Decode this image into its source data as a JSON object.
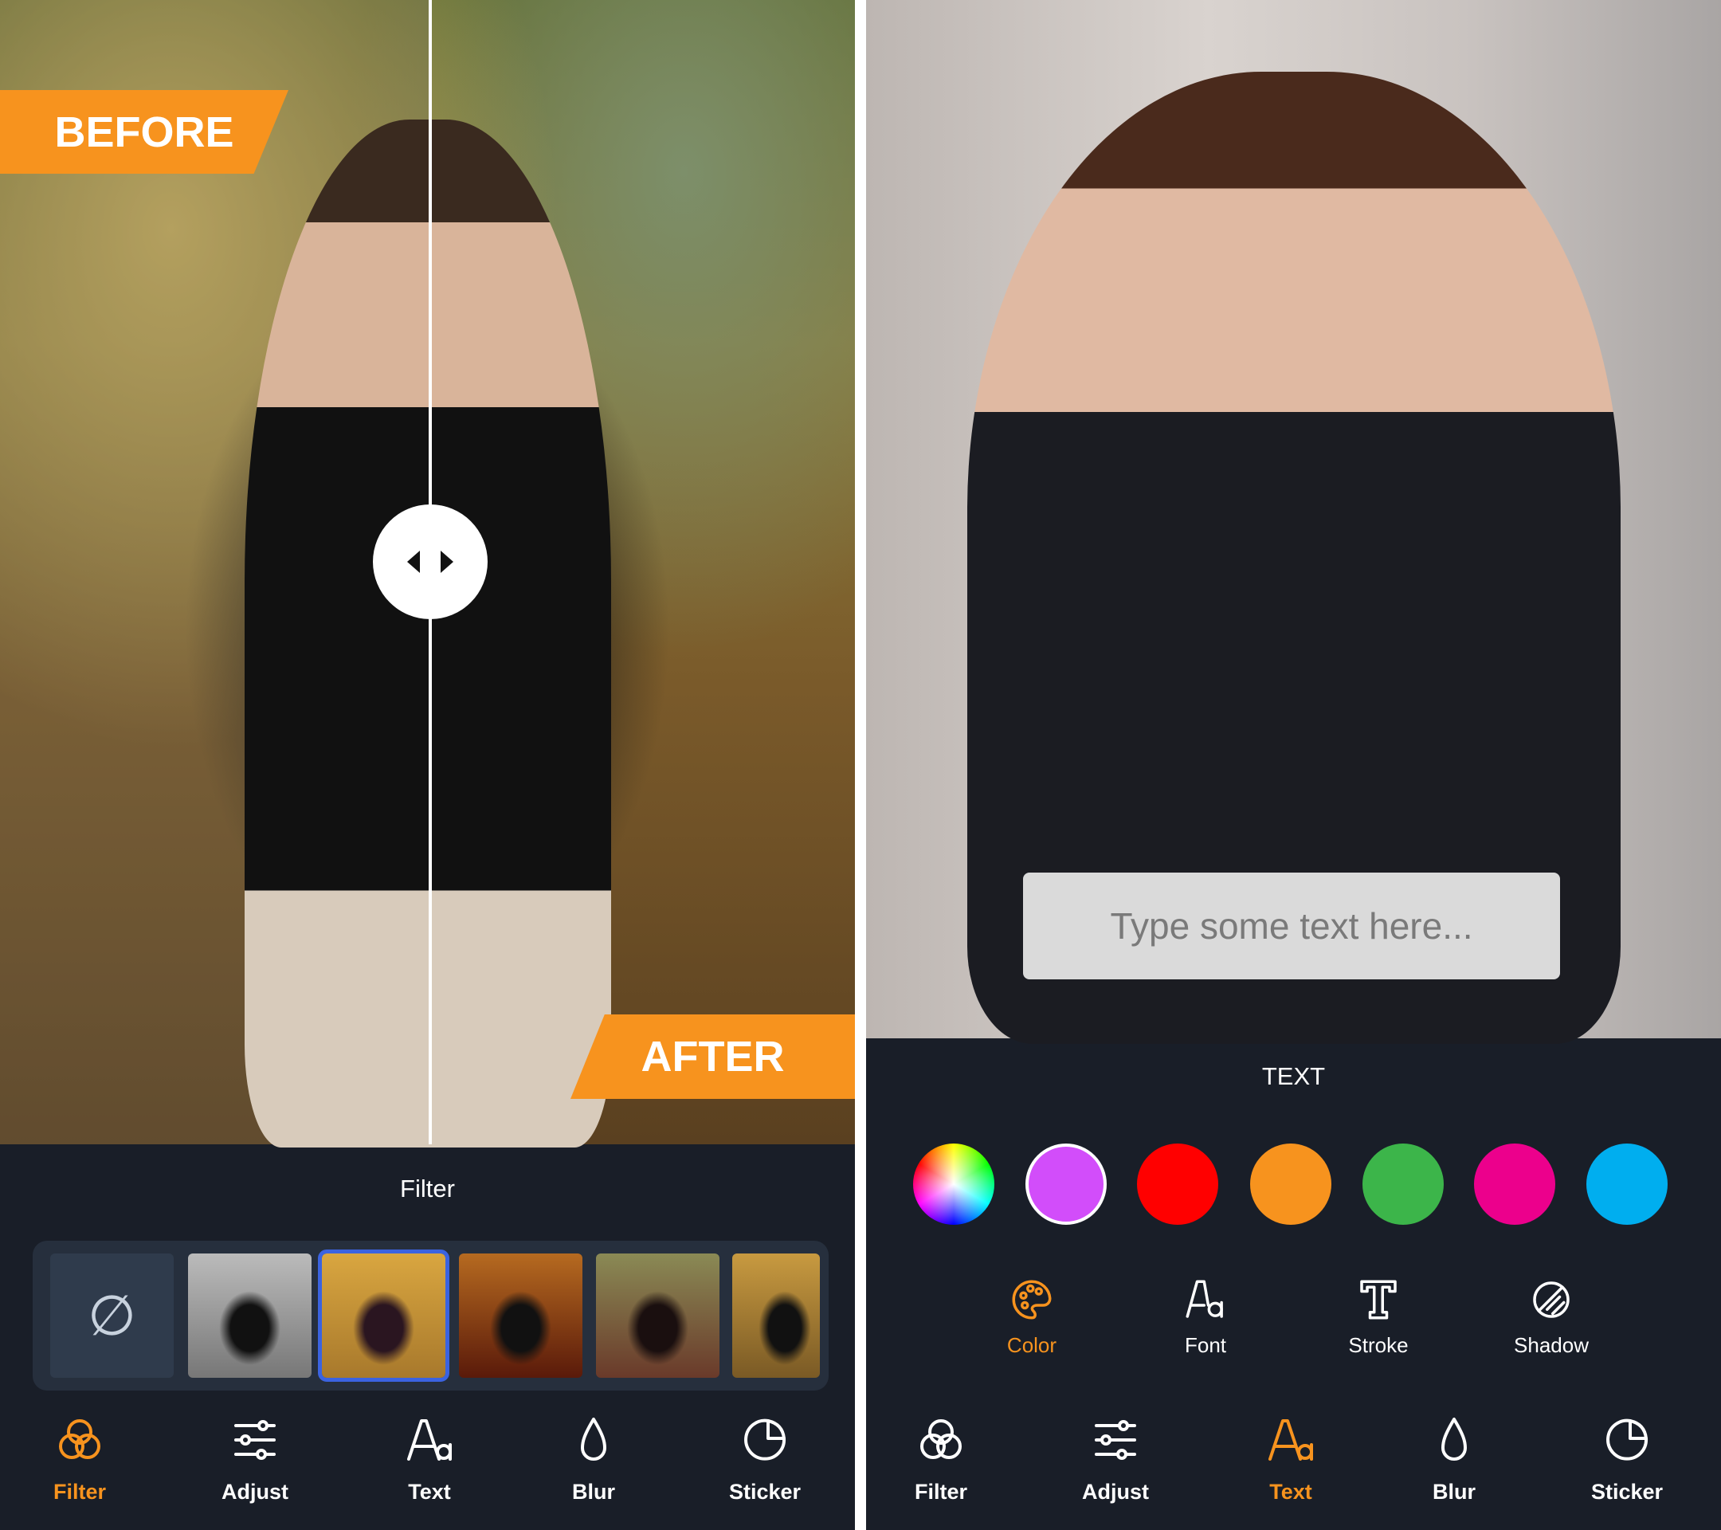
{
  "left": {
    "before_label": "BEFORE",
    "after_label": "AFTER",
    "section_title": "Filter",
    "filters": [
      {
        "name": "none",
        "icon": "no-filter-icon",
        "symbol": "∅"
      },
      {
        "name": "grayscale",
        "selected": false
      },
      {
        "name": "warm",
        "selected": true
      },
      {
        "name": "vivid-red",
        "selected": false
      },
      {
        "name": "faded",
        "selected": false
      },
      {
        "name": "golden",
        "selected": false
      }
    ],
    "nav": [
      {
        "label": "Filter",
        "icon": "filter-icon",
        "active": true
      },
      {
        "label": "Adjust",
        "icon": "sliders-icon",
        "active": false
      },
      {
        "label": "Text",
        "icon": "text-icon",
        "active": false
      },
      {
        "label": "Blur",
        "icon": "drop-icon",
        "active": false
      },
      {
        "label": "Sticker",
        "icon": "sticker-icon",
        "active": false
      }
    ]
  },
  "right": {
    "text_placeholder": "Type some text here...",
    "section_title": "TEXT",
    "swatches": [
      "rainbow",
      "#d24dfa",
      "#ff0000",
      "#f7931e",
      "#3cb54a",
      "#ec008c",
      "#00aeef"
    ],
    "selected_swatch": "#d24dfa",
    "tools": [
      {
        "label": "Color",
        "icon": "palette-icon",
        "active": true
      },
      {
        "label": "Font",
        "icon": "font-icon",
        "active": false
      },
      {
        "label": "Stroke",
        "icon": "stroke-icon",
        "active": false
      },
      {
        "label": "Shadow",
        "icon": "shadow-icon",
        "active": false
      }
    ],
    "nav": [
      {
        "label": "Filter",
        "icon": "filter-icon",
        "active": false
      },
      {
        "label": "Adjust",
        "icon": "sliders-icon",
        "active": false
      },
      {
        "label": "Text",
        "icon": "text-icon",
        "active": true
      },
      {
        "label": "Blur",
        "icon": "drop-icon",
        "active": false
      },
      {
        "label": "Sticker",
        "icon": "sticker-icon",
        "active": false
      }
    ]
  },
  "colors": {
    "accent": "#f7931e",
    "background": "#191e28",
    "strip": "#262f3d",
    "selection": "#3b63e0"
  }
}
